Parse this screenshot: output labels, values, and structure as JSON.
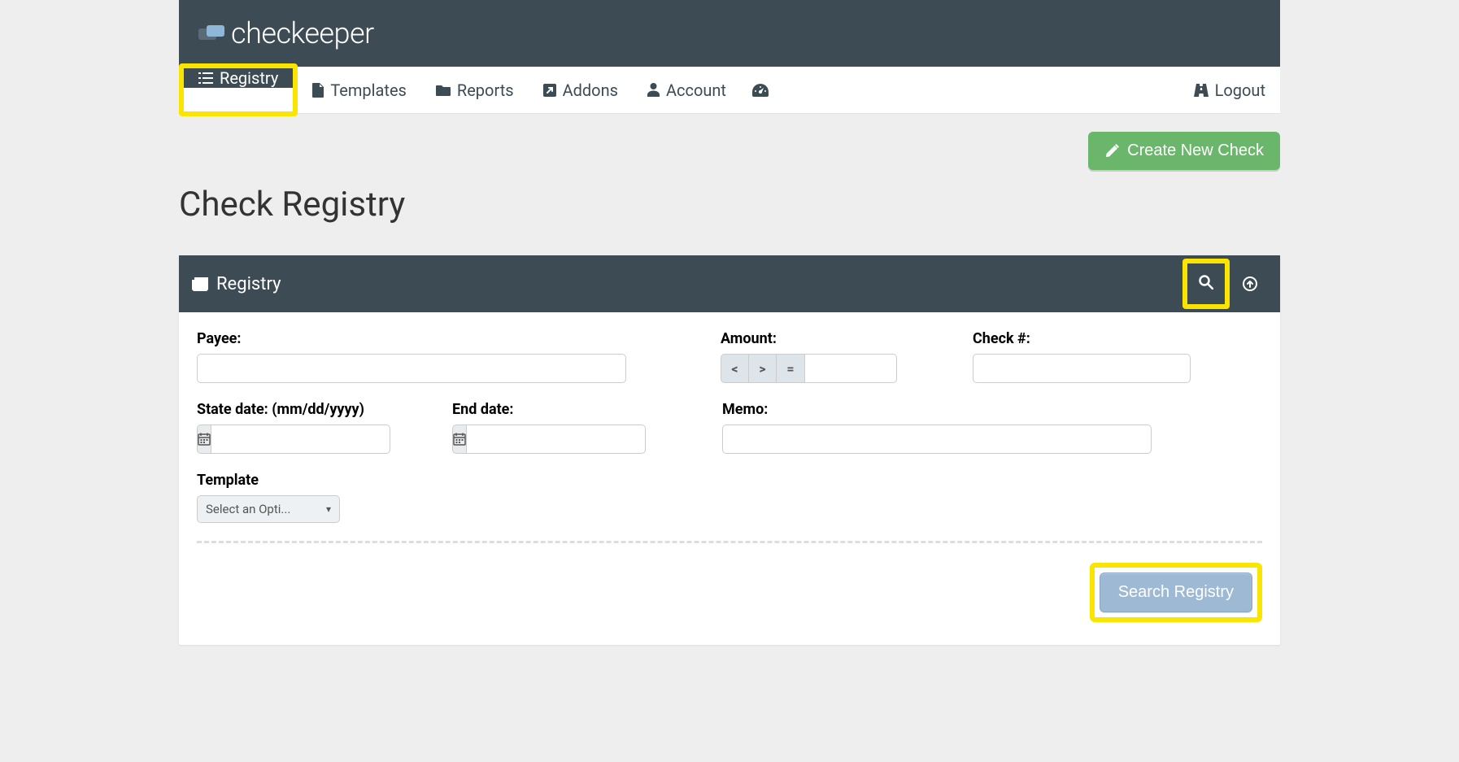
{
  "brand": {
    "name": "checkeeper"
  },
  "nav": {
    "items": [
      {
        "label": "Registry"
      },
      {
        "label": "Templates"
      },
      {
        "label": "Reports"
      },
      {
        "label": "Addons"
      },
      {
        "label": "Account"
      }
    ],
    "logout": "Logout"
  },
  "actions": {
    "create_check": "Create New Check",
    "search_registry": "Search Registry"
  },
  "page": {
    "title": "Check Registry"
  },
  "panel": {
    "title": "Registry"
  },
  "form": {
    "payee": {
      "label": "Payee:",
      "value": ""
    },
    "amount": {
      "label": "Amount:",
      "value": "",
      "ops": [
        "<",
        ">",
        "="
      ]
    },
    "check_no": {
      "label": "Check #:",
      "value": ""
    },
    "start_date": {
      "label": "State date: (mm/dd/yyyy)",
      "value": ""
    },
    "end_date": {
      "label": "End date:",
      "value": ""
    },
    "memo": {
      "label": "Memo:",
      "value": ""
    },
    "template": {
      "label": "Template",
      "selected": "Select an Opti..."
    }
  }
}
